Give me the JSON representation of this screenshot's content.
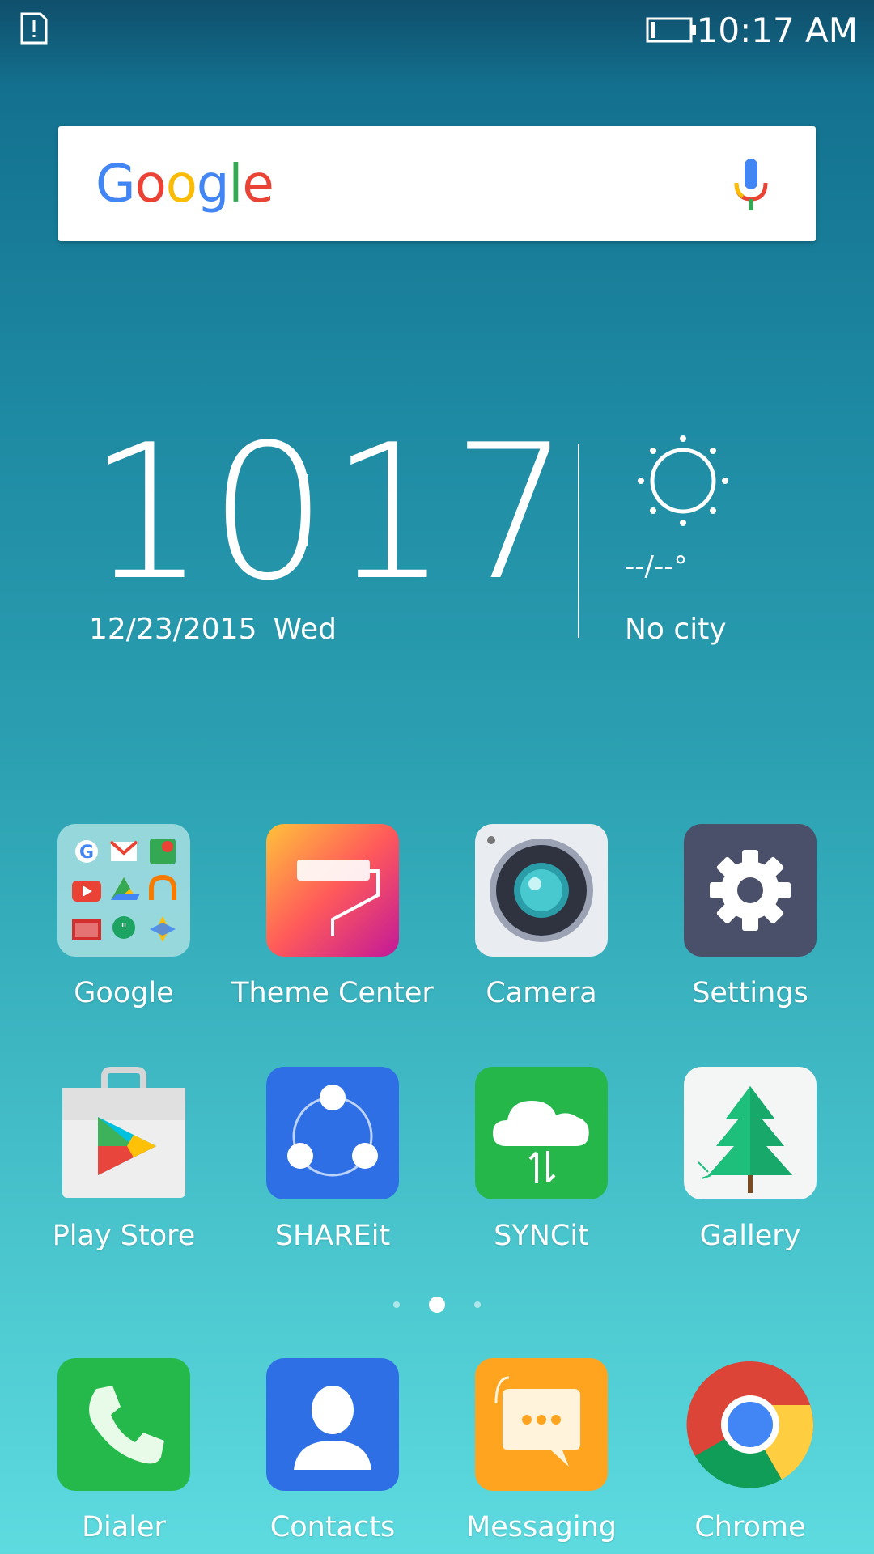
{
  "status_bar": {
    "time": "10:17 AM",
    "icons": [
      "sim-alert-icon",
      "battery-icon"
    ]
  },
  "search": {
    "logo_letters": [
      {
        "ch": "G",
        "color": "#4285F4"
      },
      {
        "ch": "o",
        "color": "#EA4335"
      },
      {
        "ch": "o",
        "color": "#FBBC05"
      },
      {
        "ch": "g",
        "color": "#4285F4"
      },
      {
        "ch": "l",
        "color": "#34A853"
      },
      {
        "ch": "e",
        "color": "#EA4335"
      }
    ],
    "icon": "mic-icon"
  },
  "clock_widget": {
    "hours": "10",
    "minutes": "17",
    "date": "12/23/2015",
    "weekday": "Wed",
    "temperature": "--/--°",
    "city": "No city",
    "weather_icon": "sun-icon"
  },
  "apps": [
    {
      "label": "Google",
      "icon": "google-folder-icon"
    },
    {
      "label": "Theme Center",
      "icon": "theme-center-icon"
    },
    {
      "label": "Camera",
      "icon": "camera-icon"
    },
    {
      "label": "Settings",
      "icon": "gear-icon"
    },
    {
      "label": "Play Store",
      "icon": "play-store-icon"
    },
    {
      "label": "SHAREit",
      "icon": "shareit-icon"
    },
    {
      "label": "SYNCit",
      "icon": "syncit-icon"
    },
    {
      "label": "Gallery",
      "icon": "gallery-icon"
    }
  ],
  "pager": {
    "pages": 3,
    "current": 2
  },
  "dock": [
    {
      "label": "Dialer",
      "icon": "phone-icon"
    },
    {
      "label": "Contacts",
      "icon": "contacts-icon"
    },
    {
      "label": "Messaging",
      "icon": "messaging-icon"
    },
    {
      "label": "Chrome",
      "icon": "chrome-icon"
    }
  ],
  "colors": {
    "google_blue": "#4285F4",
    "google_red": "#EA4335",
    "google_yellow": "#FBBC05",
    "google_green": "#34A853"
  }
}
